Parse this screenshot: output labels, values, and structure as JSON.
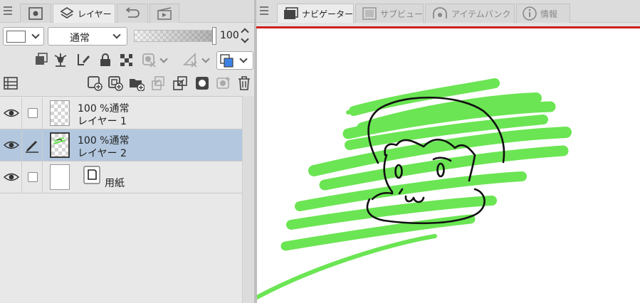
{
  "left_panel": {
    "tabs": [
      {
        "icon": "navigator-image-icon",
        "label": ""
      },
      {
        "icon": "layers-icon",
        "label": "レイヤー"
      },
      {
        "icon": "history-icon",
        "label": ""
      },
      {
        "icon": "animation-icon",
        "label": ""
      }
    ],
    "blend_mode": "通常",
    "opacity": "100",
    "opacity_fraction": 1.0,
    "layers": [
      {
        "line1": "100 %通常",
        "line2": "レイヤー 1",
        "selected": false,
        "tool": "none"
      },
      {
        "line1": "100 %通常",
        "line2": "レイヤー 2",
        "selected": true,
        "tool": "pen"
      },
      {
        "line1": "",
        "line2": "用紙",
        "selected": false,
        "tool": "none"
      }
    ],
    "accent_color": "#3c82e6"
  },
  "right_panel": {
    "tabs": [
      {
        "icon": "navigator-icon",
        "label": "ナビゲーター"
      },
      {
        "icon": "subview-icon",
        "label": "サブビュー"
      },
      {
        "icon": "item-bank-icon",
        "label": "アイテムバンク"
      },
      {
        "icon": "info-icon",
        "label": "情報"
      }
    ],
    "stroke_color": "#6be553",
    "line_color": "#111111"
  }
}
